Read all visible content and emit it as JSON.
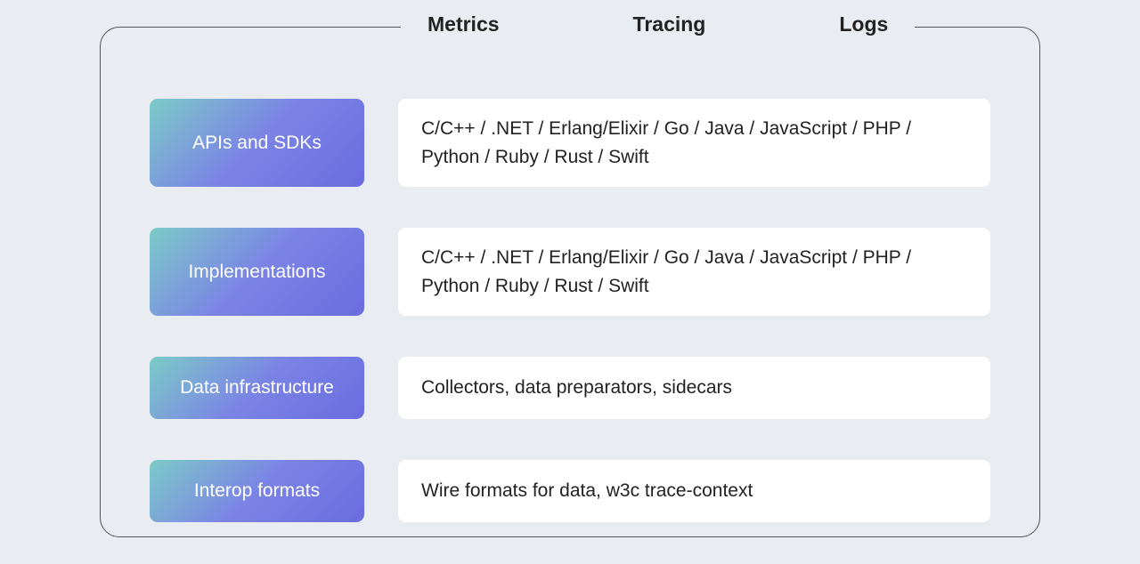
{
  "headers": {
    "col1": "Metrics",
    "col2": "Tracing",
    "col3": "Logs"
  },
  "rows": [
    {
      "label": "APIs and SDKs",
      "content": "C/C++ / .NET / Erlang/Elixir / Go / Java / JavaScript / PHP / Python / Ruby / Rust / Swift"
    },
    {
      "label": "Implementations",
      "content": "C/C++ / .NET / Erlang/Elixir / Go / Java / JavaScript / PHP / Python / Ruby / Rust / Swift"
    },
    {
      "label": "Data infrastructure",
      "content": "Collectors, data preparators, sidecars"
    },
    {
      "label": "Interop formats",
      "content": "Wire formats for data, w3c trace-context"
    }
  ]
}
